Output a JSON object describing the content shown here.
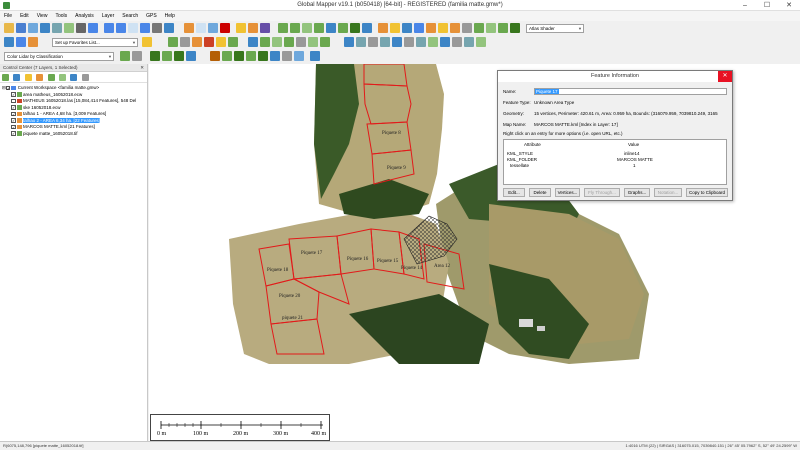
{
  "window": {
    "title": "Global Mapper v19.1 (b050418) [64-bit] - REGISTERED (familia matte.gmw*)",
    "controls": [
      "–",
      "☐",
      "✕"
    ]
  },
  "menu": [
    "File",
    "Edit",
    "View",
    "Tools",
    "Analysis",
    "Layer",
    "Search",
    "GPS",
    "Help"
  ],
  "toolbar": {
    "shader_select": "Atlas Shader",
    "favorites_select": "Set up Favorites List...",
    "color_lidar_select": "Color Lidar by Classification"
  },
  "control_center": {
    "title": "Control Center (7 Layers, 1 Selected)",
    "close": "✕",
    "layers": [
      {
        "label": "Current Workspace <familia matte.gmw>",
        "checked": true,
        "level": 0,
        "kind": "workspace"
      },
      {
        "label": "area matheus_16052018.ecw",
        "checked": true,
        "level": 1,
        "kind": "raster"
      },
      {
        "label": "MATHEUS 16052018.las [15,084,414 Features], 548 Del",
        "checked": false,
        "level": 1,
        "kind": "lidar"
      },
      {
        "label": "ske 16052018.ecw",
        "checked": true,
        "level": 1,
        "kind": "raster"
      },
      {
        "label": "talhao 1 - AREA 4,68 ha. [3,009 Features]",
        "checked": true,
        "level": 1,
        "kind": "vector"
      },
      {
        "label": "talhao 2 - AREA 6,34 ha. [22 Features]",
        "checked": true,
        "level": 1,
        "kind": "vector",
        "selected": true
      },
      {
        "label": "MARCOS MATTE.kml [21 Features]",
        "checked": true,
        "level": 1,
        "kind": "vector"
      },
      {
        "label": "piquete matte_16052018.tif",
        "checked": true,
        "level": 1,
        "kind": "raster"
      }
    ]
  },
  "map": {
    "labels": [
      {
        "text": "Piquete 8",
        "kind": "serif"
      },
      {
        "text": "Piquete 9",
        "kind": "serif"
      },
      {
        "text": "Piquete 17",
        "kind": "serif"
      },
      {
        "text": "Piquete 16",
        "kind": "serif"
      },
      {
        "text": "Piquete 15",
        "kind": "serif"
      },
      {
        "text": "Piquete 14",
        "kind": "serif"
      },
      {
        "text": "Area 12",
        "kind": "serif"
      },
      {
        "text": "Piquete 18",
        "kind": "serif"
      },
      {
        "text": "Piquete 20",
        "kind": "serif"
      },
      {
        "text": "piquete 21",
        "kind": "serif"
      }
    ],
    "colors": {
      "boundary": "#e21a1a",
      "vegetation": "#2f4a1f",
      "field": "#b5a878"
    }
  },
  "scalebar": {
    "labels": [
      "0 m",
      "100 m",
      "200 m",
      "300 m",
      "400 m"
    ]
  },
  "dialog": {
    "title": "Feature Information",
    "close": "✕",
    "name_label": "Name:",
    "name_value": "Piquete 17",
    "type_label": "Feature Type:",
    "type_value": "Unknown Area Type",
    "geometry_label": "Geometry:",
    "geometry_value": "15 vertices, Perimeter: 420.61 m, Area: 0.959 ha, Bounds: (316079.959, 7039810.249, 3165",
    "map_label": "Map Name:",
    "map_value": "MARCOS MATTE.kml [Index in Layer: 17]",
    "hint": "Right click on an entry for more options (i.e. open URL, etc.)",
    "table_headers": [
      "Attribute",
      "Value"
    ],
    "attributes": [
      {
        "attr": "KML_STYLE",
        "value": "inline14"
      },
      {
        "attr": "KML_FOLDER",
        "value": "MARCOS MATTE"
      },
      {
        "attr": "tessellate",
        "value": "1"
      }
    ],
    "buttons": [
      {
        "label": "Edit...",
        "enabled": true
      },
      {
        "label": "Delete",
        "enabled": true
      },
      {
        "label": "Vertices...",
        "enabled": true
      },
      {
        "label": "Fly Through...",
        "enabled": false
      },
      {
        "label": "Graphs...",
        "enabled": true
      },
      {
        "label": "Notation...",
        "enabled": false
      },
      {
        "label": "Copy to Clipboard",
        "enabled": true
      }
    ]
  },
  "status": {
    "left": "R(6075,148,796 [piquete matte_16052018.tif]",
    "right": "1:4016   UTM (22) | SIRGAS | 316075.015, 7039840.151 | 26° 45' 05.7962\" S, 52° 49' 24.2599\" W"
  }
}
